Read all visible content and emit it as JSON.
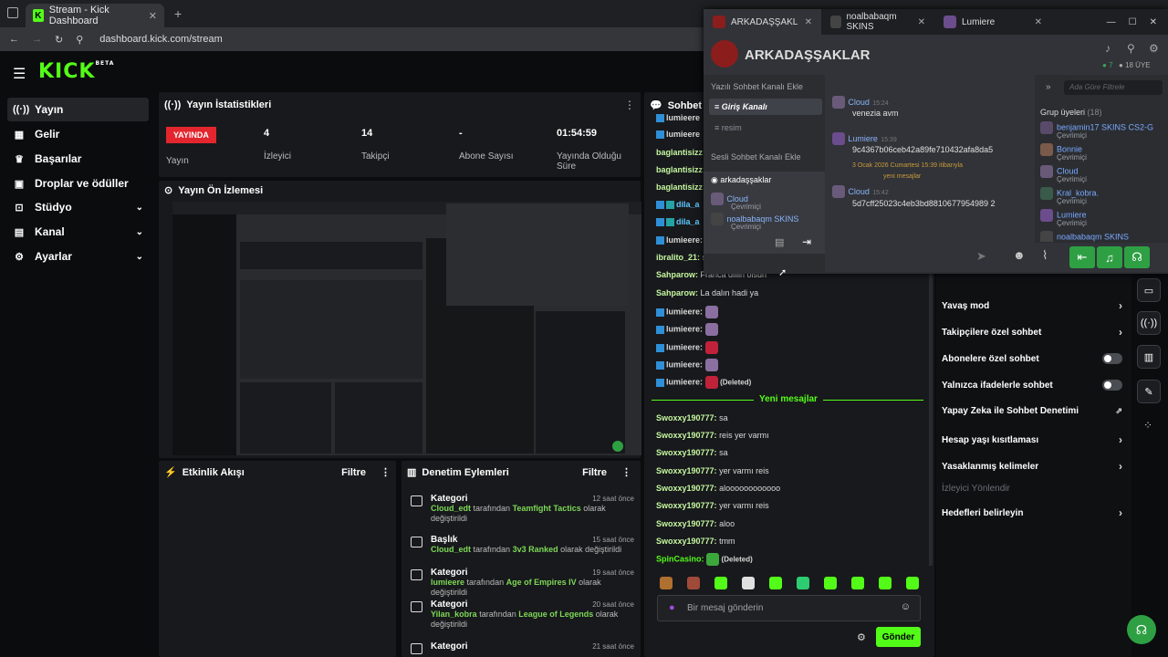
{
  "browser": {
    "tab_title": "Stream - Kick Dashboard",
    "url": "dashboard.kick.com/stream"
  },
  "brand": {
    "logo": "KICK",
    "beta": "BETA",
    "accent": "#53fc18"
  },
  "sidebar": {
    "items": [
      {
        "label": "Yayın",
        "icon": "broadcast-icon"
      },
      {
        "label": "Gelir",
        "icon": "revenue-icon"
      },
      {
        "label": "Başarılar",
        "icon": "trophy-icon"
      },
      {
        "label": "Droplar ve ödüller",
        "icon": "gift-icon"
      },
      {
        "label": "Stüdyo",
        "icon": "studio-icon"
      },
      {
        "label": "Kanal",
        "icon": "channel-icon"
      },
      {
        "label": "Ayarlar",
        "icon": "gear-icon"
      }
    ]
  },
  "stats": {
    "title": "Yayın İstatistikleri",
    "live_badge": "YAYINDA",
    "live_label": "Yayın",
    "cols": [
      {
        "value": "4",
        "label": "İzleyici"
      },
      {
        "value": "14",
        "label": "Takipçi"
      },
      {
        "value": "-",
        "label": "Abone Sayısı"
      },
      {
        "value": "01:54:59",
        "label": "Yayında Olduğu Süre"
      }
    ]
  },
  "preview": {
    "title": "Yayın Ön İzlemesi"
  },
  "activity": {
    "title": "Etkinlik Akışı",
    "filter": "Filtre"
  },
  "mod": {
    "title": "Denetim Eylemleri",
    "filter": "Filtre",
    "rows": [
      {
        "type": "Kategori",
        "time": "12 saat önce",
        "user": "Cloud_edt",
        "mid": "tarafından",
        "target": "Teamfight Tactics",
        "end": "olarak değiştirildi"
      },
      {
        "type": "Başlık",
        "time": "15 saat önce",
        "user": "Cloud_edt",
        "mid": "tarafından",
        "target": "3v3 Ranked",
        "end": "olarak değiştirildi"
      },
      {
        "type": "Kategori",
        "time": "19 saat önce",
        "user": "lumieere",
        "mid": "tarafından",
        "target": "Age of Empires IV",
        "end": "olarak değiştirildi"
      },
      {
        "type": "Kategori",
        "time": "20 saat önce",
        "user": "Yilan_kobra",
        "mid": "tarafından",
        "target": "League of Legends",
        "end": "olarak değiştirildi"
      },
      {
        "type": "Kategori",
        "time": "21 saat önce",
        "user": "",
        "mid": "",
        "target": "",
        "end": ""
      }
    ]
  },
  "chat": {
    "title": "Sohbet",
    "new_messages": "Yeni mesajlar",
    "placeholder": "Bir mesaj gönderin",
    "send": "Gönder",
    "top": [
      {
        "user": "lumieere",
        "text": ""
      },
      {
        "user": "lumieere",
        "text": ""
      },
      {
        "user": "baglantisizz:",
        "text": ""
      },
      {
        "user": "baglantisizz:",
        "text": ""
      },
      {
        "user": "baglantisizz:",
        "text": ""
      },
      {
        "user": "dila_a",
        "text": ""
      },
      {
        "user": "dila_a",
        "text": ""
      },
      {
        "user": "lumieere:",
        "text": ""
      },
      {
        "user": "ibralito_21:",
        "text": "sa"
      },
      {
        "user": "Sahparow:",
        "text": "Franca dillin olsun"
      },
      {
        "user": "Sahparow:",
        "text": "La dalın hadi ya"
      },
      {
        "user": "lumieere:",
        "text": ""
      },
      {
        "user": "lumieere:",
        "text": ""
      },
      {
        "user": "lumieere:",
        "text": ""
      },
      {
        "user": "lumieere:",
        "text": ""
      },
      {
        "user": "lumieere:",
        "text": "(Deleted)"
      }
    ],
    "bottom": [
      {
        "user": "Swoxxy190777:",
        "text": "sa"
      },
      {
        "user": "Swoxxy190777:",
        "text": "reis yer varmı"
      },
      {
        "user": "Swoxxy190777:",
        "text": "sa"
      },
      {
        "user": "Swoxxy190777:",
        "text": "yer varmı reis"
      },
      {
        "user": "Swoxxy190777:",
        "text": "aloooooooooooo"
      },
      {
        "user": "Swoxxy190777:",
        "text": "yer varmı reis"
      },
      {
        "user": "Swoxxy190777:",
        "text": "aloo"
      },
      {
        "user": "Swoxxy190777:",
        "text": "tmm"
      },
      {
        "user": "SpinCasino:",
        "text": "(Deleted)"
      }
    ]
  },
  "settings": {
    "items": [
      {
        "label": "Yavaş mod",
        "ctl": "arrow"
      },
      {
        "label": "Takipçilere özel sohbet",
        "ctl": "arrow"
      },
      {
        "label": "Abonelere özel sohbet",
        "ctl": "toggle"
      },
      {
        "label": "Yalnızca ifadelerle sohbet",
        "ctl": "toggle"
      },
      {
        "label": "Yapay Zeka ile Sohbet Denetimi",
        "ctl": "ext"
      },
      {
        "label": "Hesap yaşı kısıtlaması",
        "ctl": "arrow"
      },
      {
        "label": "Yasaklanmış kelimeler",
        "ctl": "arrow"
      },
      {
        "label": "İzleyici Yönlendir",
        "ctl": "none"
      },
      {
        "label": "Hedefleri belirleyin",
        "ctl": "arrow"
      }
    ]
  },
  "discord": {
    "tabs": [
      "ARKADAŞŞAKL",
      "noalbabaqm SKINS",
      "Lumiere"
    ],
    "server": "ARKADAŞŞAKLAR",
    "online": "7",
    "members": "18 ÜYE",
    "search_placeholder": "Ada Göre Filtrele",
    "channels": {
      "text_header": "Yazılı Sohbet Kanalı Ekle",
      "ch1": "Giriş Kanalı",
      "ch2": "resim",
      "voice_header": "Sesli Sohbet Kanalı Ekle",
      "voice": "arkadaşşaklar"
    },
    "voice_users": [
      {
        "name": "Cloud",
        "status": "Çevrimiçi"
      },
      {
        "name": "noalbabaqm SKINS",
        "status": "Çevrimiçi"
      }
    ],
    "messages": [
      {
        "name": "Cloud",
        "time": "15:24",
        "text": "venezia avm"
      },
      {
        "name": "Lumiere",
        "time": "15:39",
        "text": "9c4367b06ceb42a89fe710432afa8da5"
      },
      {
        "name": "Cloud",
        "time": "15:42",
        "text": "5d7cff25023c4eb3bd8810677954989 2"
      }
    ],
    "divider": "3 Ocak 2026 Cumartesi 15:39 itibarıyla",
    "divider2": "yeni mesajlar",
    "group_title": "Grup üyeleri",
    "group_count": "(18)",
    "group": [
      {
        "name": "benjamin17 SKINS CS2-G",
        "status": "Çevrimiçi"
      },
      {
        "name": "Bonnie",
        "status": "Çevrimiçi"
      },
      {
        "name": "Cloud",
        "status": "Çevrimiçi"
      },
      {
        "name": "Kral_kobra.",
        "status": "Çevrimiçi"
      },
      {
        "name": "Lumiere",
        "status": "Çevrimiçi"
      },
      {
        "name": "noalbabaqm SKINS",
        "status": ""
      }
    ]
  }
}
